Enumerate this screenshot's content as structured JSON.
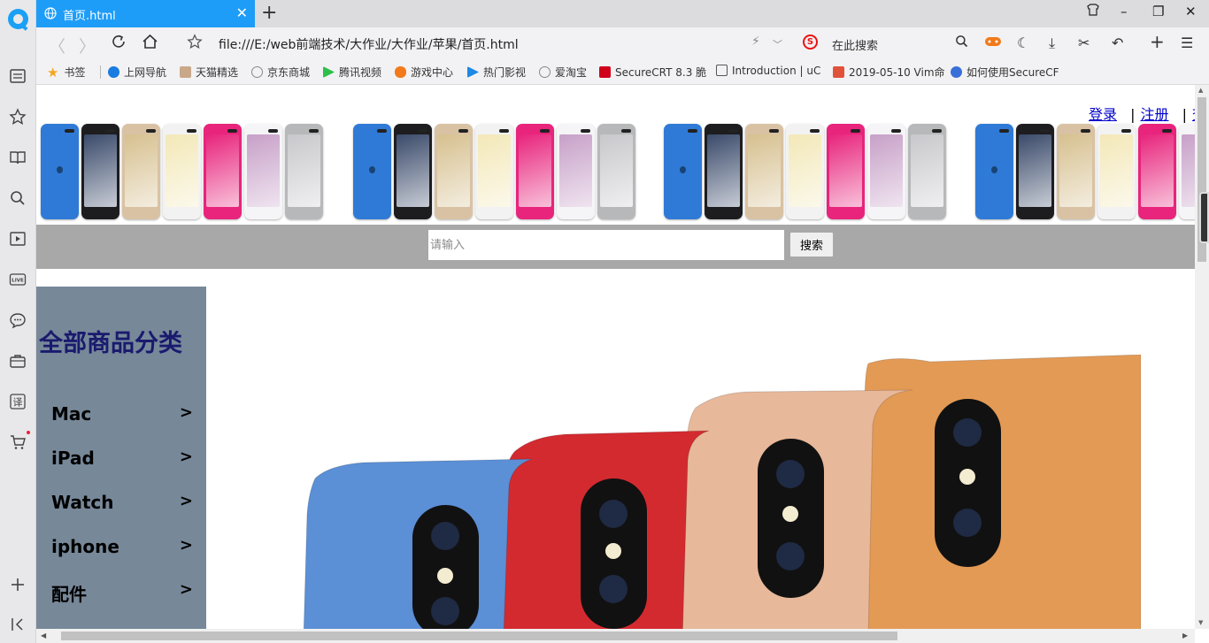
{
  "browser": {
    "tab_title": "首页.html",
    "address": "file:///E:/web前端技术/大作业/大作业/苹果/首页.html",
    "search_placeholder": "在此搜索",
    "search_engine_letter": "S"
  },
  "bookmarks": [
    {
      "label": "书签",
      "color": "#f5a623"
    },
    {
      "label": "上网导航",
      "color": "#1a7ce0"
    },
    {
      "label": "天猫精选",
      "color": "#c9a88a"
    },
    {
      "label": "京东商城",
      "color": "#888888"
    },
    {
      "label": "腾讯视频",
      "color": "#2cbf4a"
    },
    {
      "label": "游戏中心",
      "color": "#f27a1a"
    },
    {
      "label": "热门影视",
      "color": "#1e88e5"
    },
    {
      "label": "爱淘宝",
      "color": "#888888"
    },
    {
      "label": "SecureCRT 8.3 脆",
      "color": "#d0021b"
    },
    {
      "label": "Introduction | uC",
      "color": "#555555"
    },
    {
      "label": "2019-05-10 Vim命",
      "color": "#e0533a"
    },
    {
      "label": "如何使用SecureCF",
      "color": "#3a6fd8"
    }
  ],
  "page": {
    "auth": {
      "login": "登录",
      "register": "注册",
      "more": "查"
    },
    "search": {
      "placeholder": "请输入",
      "button": "搜索"
    },
    "category": {
      "title": "全部商品分类",
      "items": [
        {
          "label": "Mac",
          "arrow": ">"
        },
        {
          "label": "iPad",
          "arrow": ">"
        },
        {
          "label": "Watch",
          "arrow": ">"
        },
        {
          "label": "iphone",
          "arrow": ">"
        },
        {
          "label": "配件",
          "arrow": ">"
        }
      ]
    },
    "ipod_colors": [
      "#2f7ad6",
      "#1d1d1f",
      "#d9c2a3",
      "#f2f2f2",
      "#e8247c",
      "#f5f5f7",
      "#b7b8ba"
    ],
    "hero_phone_colors": [
      "#5b8fd6",
      "#d32a30",
      "#e8b89a",
      "#e39a55"
    ]
  }
}
